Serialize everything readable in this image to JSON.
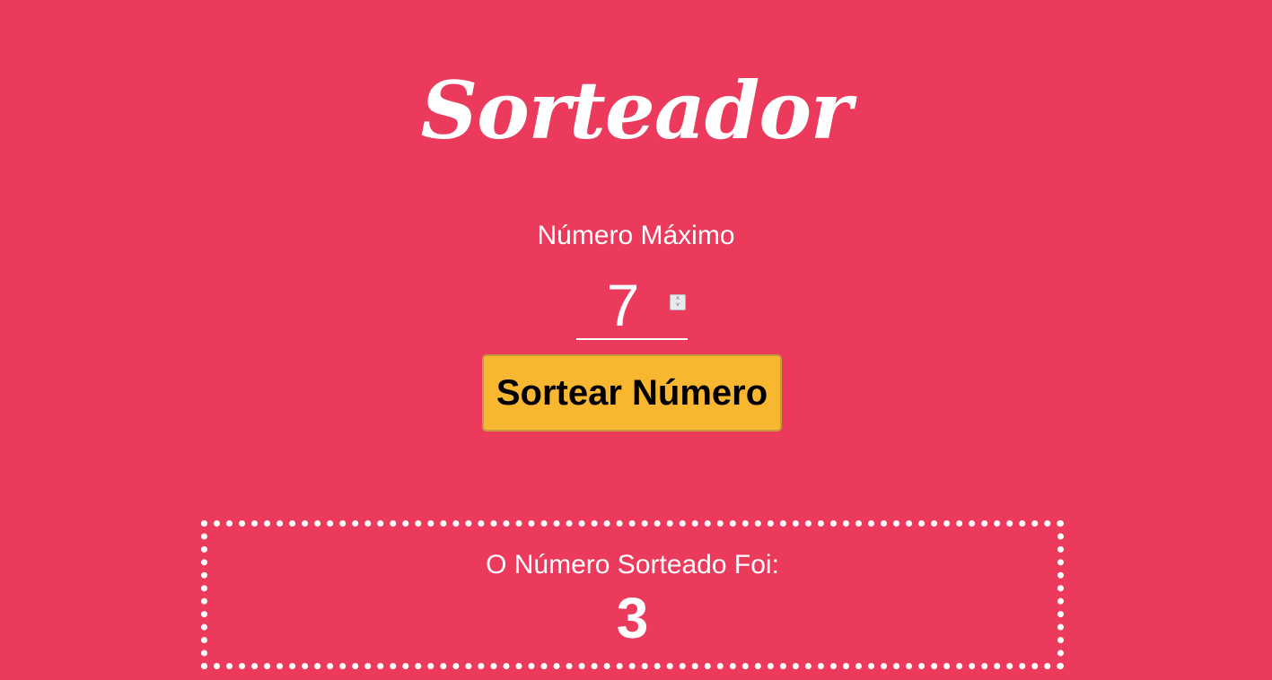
{
  "page": {
    "title": "Sorteador",
    "background_color": "#EB3A5C"
  },
  "form": {
    "max_label": "Número Máximo",
    "max_value": "7",
    "spinner_icon": "spinner-arrows",
    "button_label": "Sortear Número",
    "button_color": "#F7B731"
  },
  "result": {
    "label": "O Número Sorteado Foi:",
    "value": "3"
  }
}
